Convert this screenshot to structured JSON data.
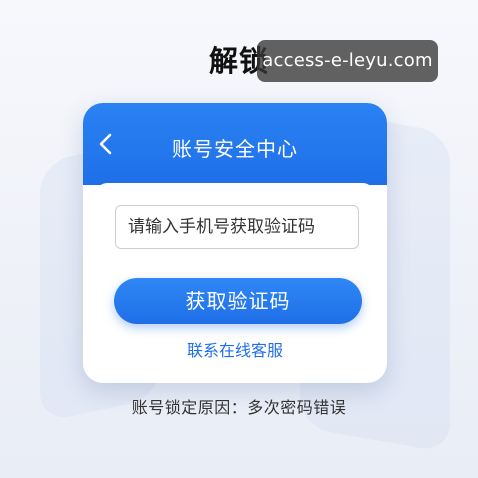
{
  "page": {
    "title": "解锁",
    "watermark": "access-e-leyu.com"
  },
  "header": {
    "back_icon": "chevron-left-icon",
    "title": "账号安全中心"
  },
  "form": {
    "phone_placeholder": "请输入手机号获取验证码",
    "get_code_label": "获取验证码",
    "support_link_label": "联系在线客服"
  },
  "footer": {
    "lock_reason": "账号锁定原因：多次密码错误"
  },
  "colors": {
    "accent": "#1f6fe8",
    "header_bg": "#2a82f2",
    "background": "#f3f5fa"
  }
}
